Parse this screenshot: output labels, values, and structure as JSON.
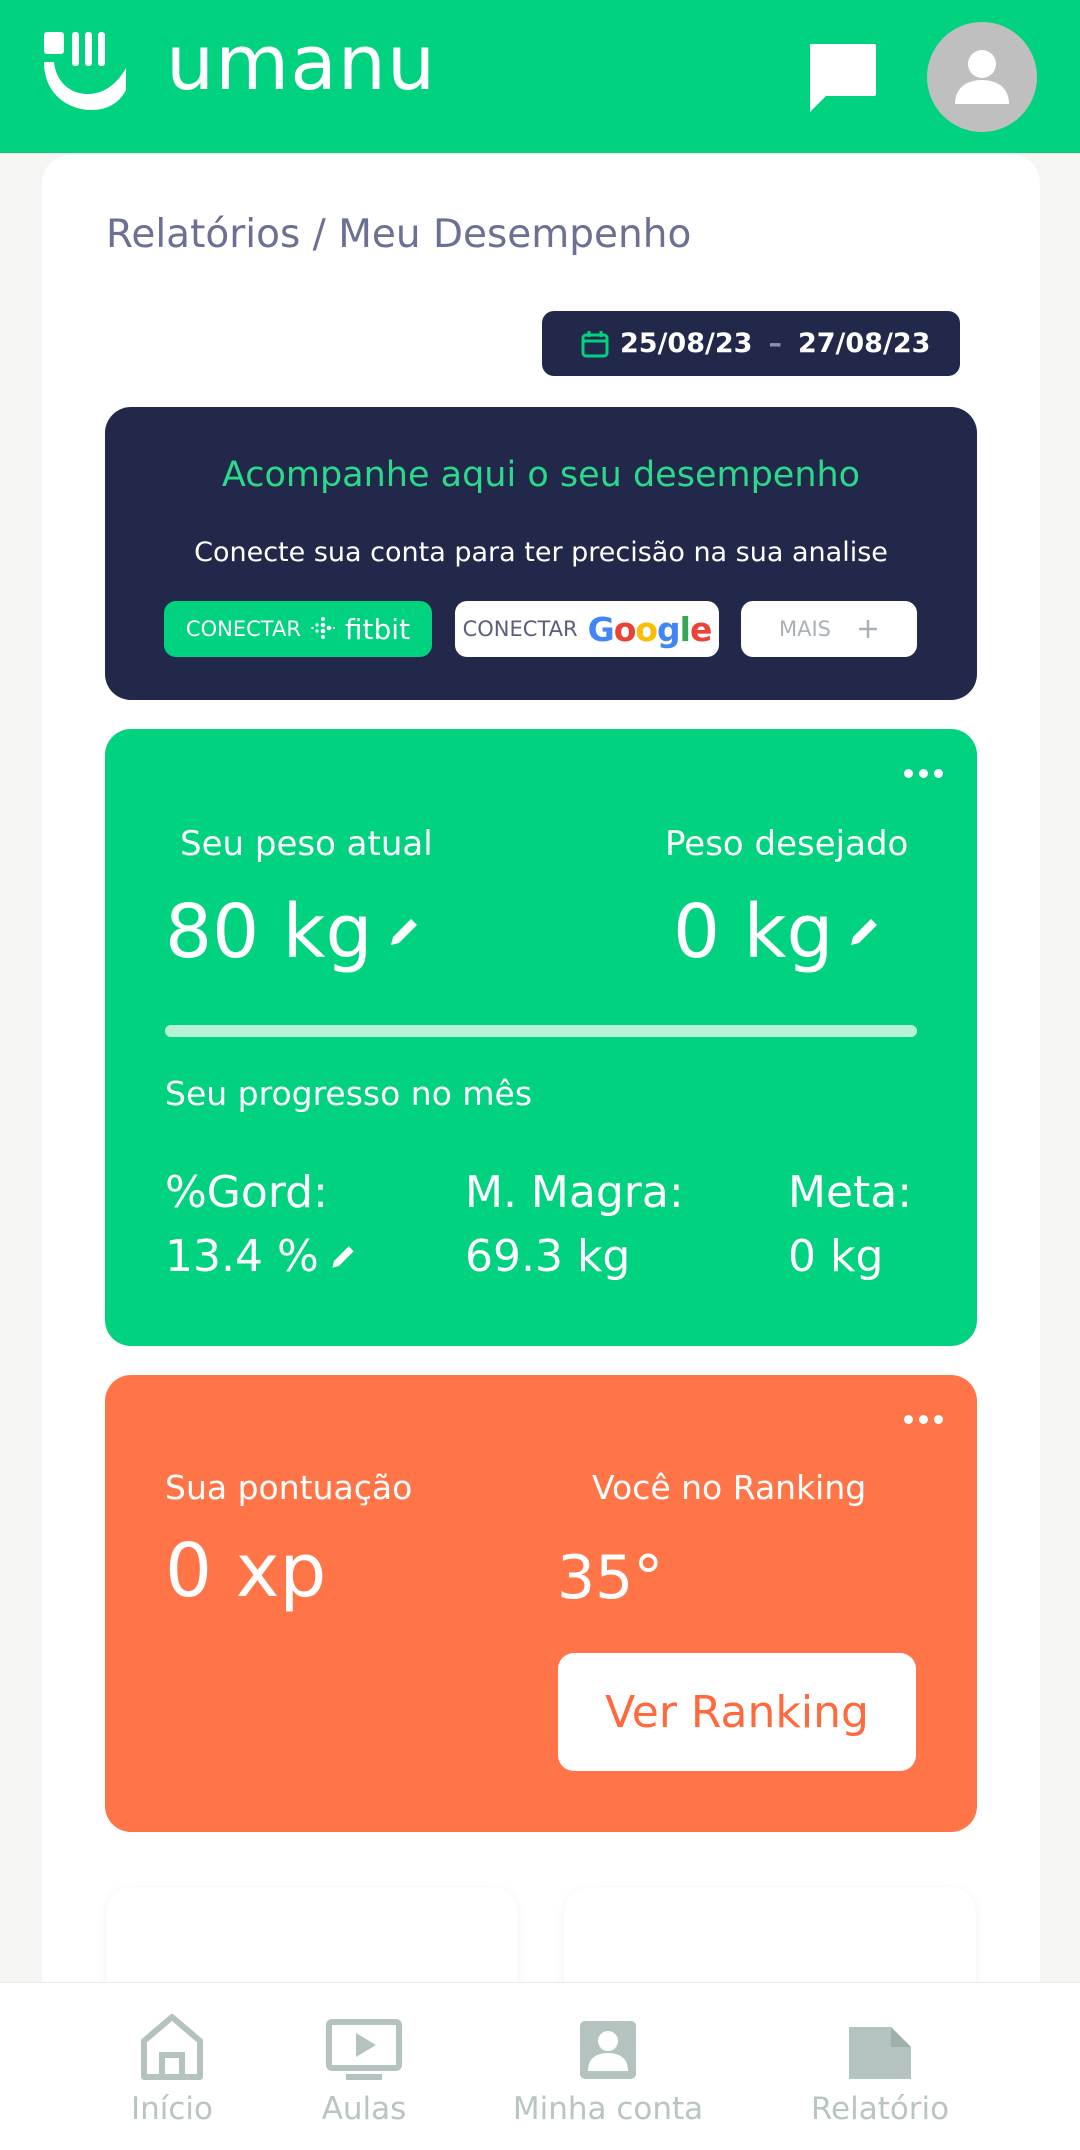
{
  "header": {
    "app_name": "umanu",
    "icons": {
      "logo": "umanu-logo-icon",
      "chat": "chat-icon",
      "avatar": "user-icon"
    }
  },
  "breadcrumb": "Relatórios / Meu Desempenho",
  "date_range": {
    "start": "25/08/23",
    "separator": "–",
    "end": "27/08/23",
    "icon": "calendar-icon"
  },
  "connect_banner": {
    "title": "Acompanhe aqui o seu desempenho",
    "subtitle": "Conecte sua conta para ter precisão na sua analise",
    "fitbit_label": "CONECTAR",
    "fitbit_brand": "fitbit",
    "google_label": "CONECTAR",
    "google_brand": [
      "G",
      "o",
      "o",
      "g",
      "l",
      "e"
    ],
    "more_label": "MAIS"
  },
  "weight_card": {
    "current_label": "Seu peso atual",
    "current_value": "80 kg",
    "target_label": "Peso desejado",
    "target_value": "0 kg",
    "progress_fraction": 1.0,
    "progress_label": "Seu progresso no mês",
    "fat_label": "%Gord:",
    "fat_value": "13.4 %",
    "lean_label": "M. Magra:",
    "lean_value": "69.3 kg",
    "goal_label": "Meta:",
    "goal_value": "0 kg"
  },
  "score_card": {
    "points_label": "Sua pontuação",
    "points_value": "0 xp",
    "ranking_label": "Você no Ranking",
    "ranking_value": "35°",
    "ranking_button": "Ver Ranking"
  },
  "bottom_nav": [
    {
      "label": "Início",
      "icon": "home-icon"
    },
    {
      "label": "Aulas",
      "icon": "play-icon"
    },
    {
      "label": "Minha conta",
      "icon": "account-icon"
    },
    {
      "label": "Relatório",
      "icon": "report-icon"
    }
  ],
  "colors": {
    "brand_green": "#00d27f",
    "navy": "#22284a",
    "orange": "#ff7548",
    "nav_icon": "#b4c3bf"
  }
}
